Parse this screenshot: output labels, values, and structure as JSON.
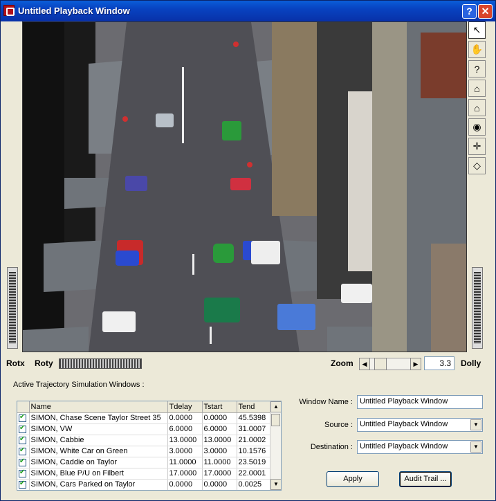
{
  "window": {
    "title": "Untitled Playback Window",
    "help_label": "?",
    "close_label": "✕"
  },
  "toolbar": {
    "tools": [
      {
        "icon": "arrow-pointer-icon",
        "glyph": "↖"
      },
      {
        "icon": "hand-pan-icon",
        "glyph": "✋"
      },
      {
        "icon": "question-icon",
        "glyph": "?"
      },
      {
        "icon": "home-icon",
        "glyph": "⌂"
      },
      {
        "icon": "home-set-icon",
        "glyph": "⌂"
      },
      {
        "icon": "eye-icon",
        "glyph": "◉"
      },
      {
        "icon": "crosshair-icon",
        "glyph": "✛"
      },
      {
        "icon": "perspective-icon",
        "glyph": "◇"
      }
    ]
  },
  "controls": {
    "rotx_label": "Rotx",
    "roty_label": "Roty",
    "zoom_label": "Zoom",
    "zoom_value": "3.3",
    "dolly_label": "Dolly"
  },
  "trajectory": {
    "section_label": "Active Trajectory Simulation Windows :",
    "columns": [
      "Name",
      "Tdelay",
      "Tstart",
      "Tend"
    ],
    "rows": [
      {
        "name": "SIMON, Chase Scene Taylor Street 35",
        "tdelay": "0.0000",
        "tstart": "0.0000",
        "tend": "45.5398"
      },
      {
        "name": "SIMON, VW",
        "tdelay": "6.0000",
        "tstart": "6.0000",
        "tend": "31.0007"
      },
      {
        "name": "SIMON, Cabbie",
        "tdelay": "13.0000",
        "tstart": "13.0000",
        "tend": "21.0002"
      },
      {
        "name": "SIMON, White Car on Green",
        "tdelay": "3.0000",
        "tstart": "3.0000",
        "tend": "10.1576"
      },
      {
        "name": "SIMON, Caddie on Taylor",
        "tdelay": "11.0000",
        "tstart": "11.0000",
        "tend": "23.5019"
      },
      {
        "name": "SIMON, Blue P/U on Filbert",
        "tdelay": "17.0000",
        "tstart": "17.0000",
        "tend": "22.0001"
      },
      {
        "name": "SIMON, Cars Parked on Taylor",
        "tdelay": "0.0000",
        "tstart": "0.0000",
        "tend": "0.0025"
      }
    ]
  },
  "form": {
    "window_name_label": "Window Name :",
    "window_name_value": "Untitled Playback Window",
    "source_label": "Source :",
    "source_value": "Untitled Playback Window",
    "destination_label": "Destination :",
    "destination_value": "Untitled Playback Window",
    "apply_label": "Apply",
    "audit_label": "Audit Trail ..."
  }
}
